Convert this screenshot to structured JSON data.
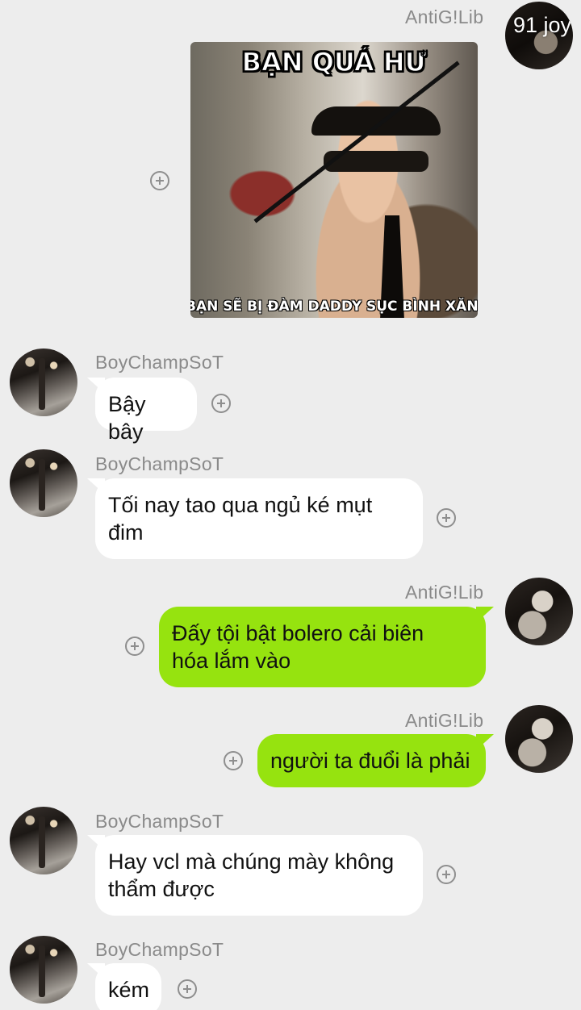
{
  "colors": {
    "background": "#ededed",
    "incoming_bubble": "#ffffff",
    "outgoing_bubble": "#96e30f",
    "sender_name": "#8a8a8a"
  },
  "top_message": {
    "sender": "AntiG!Lib",
    "avatar_label": "91 joy",
    "meme": {
      "caption_top": "BẠN QUÁ HƯ",
      "caption_bottom": "BẠN SẼ BỊ ĐÀM DADDY SỤC BÌNH XĂNG"
    }
  },
  "messages": [
    {
      "sender": "BoyChampSoT",
      "text": "Bậy bây"
    },
    {
      "sender": "BoyChampSoT",
      "lines": [
        "Tối nay tao qua ngủ ké mụt",
        "đim"
      ]
    },
    {
      "sender": "AntiG!Lib",
      "lines": [
        "Đấy tội bật bolero cải biên",
        "hóa  lắm vào"
      ]
    },
    {
      "sender": "AntiG!Lib",
      "text": "người ta đuổi là phải"
    },
    {
      "sender": "BoyChampSoT",
      "lines": [
        "Hay vcl mà chúng mày không",
        "thẩm được"
      ]
    },
    {
      "sender": "BoyChampSoT",
      "text": "kém"
    }
  ]
}
